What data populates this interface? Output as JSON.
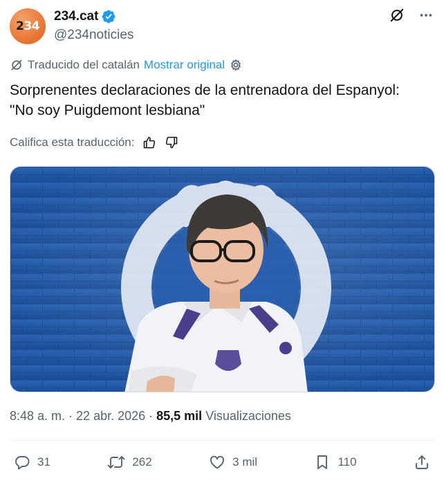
{
  "account": {
    "avatar_text_a": "2",
    "avatar_text_b": "34",
    "display_name": "234.cat",
    "handle": "@234noticies"
  },
  "translation": {
    "label": "Traducido del catalán",
    "show_original": "Mostrar original"
  },
  "tweet": {
    "line1": "Sorprenentes declaraciones de la entrenadora del Espanyol:",
    "line2": "\"No soy Puigdemont lesbiana\""
  },
  "rate": {
    "label": "Califica esta traducción:"
  },
  "meta": {
    "time": "8:48 a. m.",
    "sep1": " · ",
    "date": "22 abr. 2026",
    "sep2": " · ",
    "views_count": "85,5 mil",
    "views_label": " Visualizaciones"
  },
  "actions": {
    "replies": "31",
    "reposts": "262",
    "likes": "3 mil",
    "bookmarks": "110"
  },
  "colors": {
    "accent": "#1d9bf0",
    "secondary_text": "#536471",
    "avatar_orange": "#e8722f",
    "club_blue": "#1f57a6"
  },
  "icons": [
    "grok-icon",
    "more-icon",
    "translate-icon",
    "gear-icon",
    "thumbs-up-icon",
    "thumbs-down-icon",
    "reply-icon",
    "repost-icon",
    "like-icon",
    "bookmark-icon",
    "share-icon",
    "verified-badge-icon"
  ]
}
